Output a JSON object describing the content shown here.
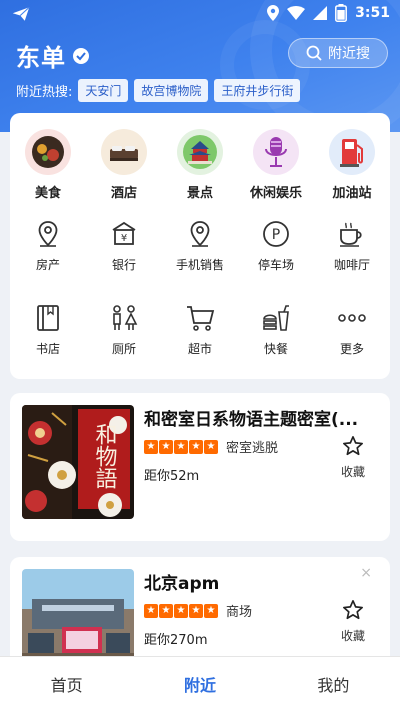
{
  "status": {
    "time": "3:51",
    "battery_level": 0.7
  },
  "header": {
    "city": "东单",
    "search_label": "附近搜",
    "hot_label": "附近热搜:",
    "hot_tags": [
      "天安门",
      "故宫博物院",
      "王府井步行街"
    ]
  },
  "categories_main": [
    {
      "label": "美食",
      "icon": "food-icon",
      "bg": "#f9e2e0"
    },
    {
      "label": "酒店",
      "icon": "hotel-bed-icon",
      "bg": "#f6ebdc"
    },
    {
      "label": "景点",
      "icon": "temple-icon",
      "bg": "#e3f2e0"
    },
    {
      "label": "休闲娱乐",
      "icon": "microphone-icon",
      "bg": "#f4e4f5"
    },
    {
      "label": "加油站",
      "icon": "gas-pump-icon",
      "bg": "#e2ecfa"
    }
  ],
  "categories_row2": [
    {
      "label": "房产",
      "icon": "location-pin-icon"
    },
    {
      "label": "银行",
      "icon": "bank-icon"
    },
    {
      "label": "手机销售",
      "icon": "location-pin-icon"
    },
    {
      "label": "停车场",
      "icon": "parking-icon"
    },
    {
      "label": "咖啡厅",
      "icon": "coffee-cup-icon"
    }
  ],
  "categories_row3": [
    {
      "label": "书店",
      "icon": "book-icon"
    },
    {
      "label": "厕所",
      "icon": "restroom-icon"
    },
    {
      "label": "超市",
      "icon": "shopping-cart-icon"
    },
    {
      "label": "快餐",
      "icon": "fast-food-icon"
    },
    {
      "label": "更多",
      "icon": "more-dots-icon"
    }
  ],
  "places": [
    {
      "title": "和密室日系物语主题密室(...",
      "category": "密室逃脱",
      "distance": "距你52m",
      "stars": 5,
      "fav_label": "收藏",
      "thumb_text": "和物語"
    },
    {
      "title": "北京apm",
      "category": "商场",
      "distance": "距你270m",
      "stars": 5,
      "fav_label": "收藏",
      "close": "×"
    }
  ],
  "tabs": [
    {
      "label": "首页",
      "active": false
    },
    {
      "label": "附近",
      "active": true
    },
    {
      "label": "我的",
      "active": false
    }
  ],
  "colors": {
    "primary": "#2f6fe0",
    "star": "#ff6a00"
  }
}
